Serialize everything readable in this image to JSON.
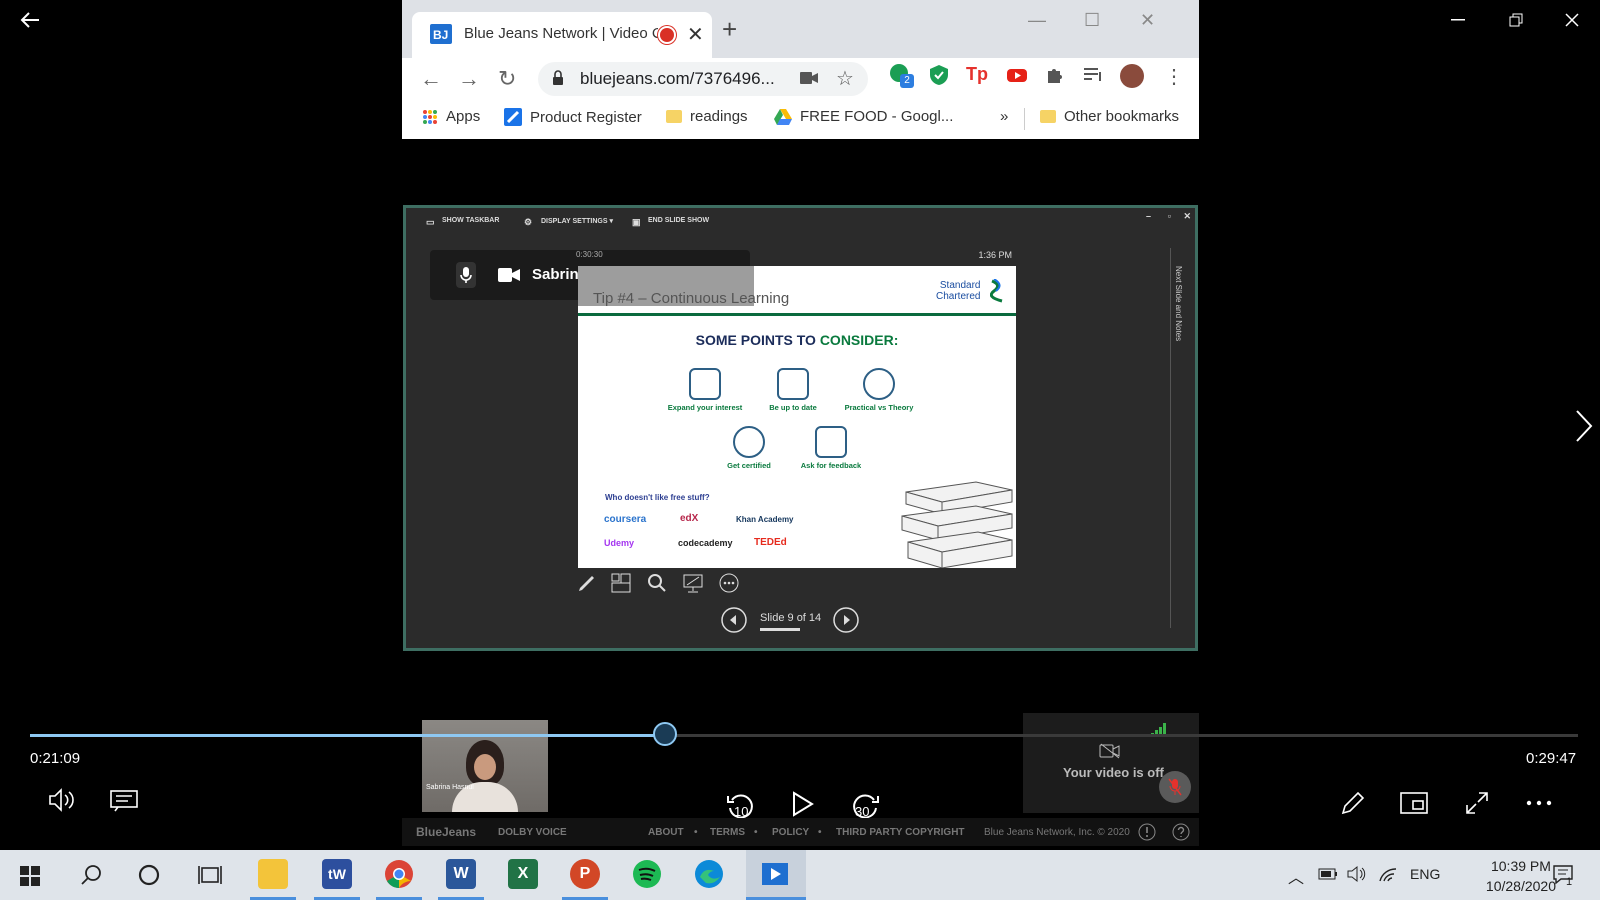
{
  "browser": {
    "tab_title": "Blue Jeans Network | Video C",
    "url": "bluejeans.com/7376496...",
    "bookmarks": [
      "Apps",
      "Product Register",
      "readings",
      "FREE FOOD - Googl...",
      "Other bookmarks"
    ],
    "more_bookmarks": "»",
    "extension_badge": "2"
  },
  "presentation": {
    "toolbar": [
      "SHOW TASKBAR",
      "DISPLAY SETTINGS ▾",
      "END SLIDE SHOW"
    ],
    "speaker_status": "Sabrina Hasnul is talking",
    "elapsed": "0:30:30",
    "clock": "1:36 PM",
    "side_label": "Next Slide and Notes",
    "slide_counter": "Slide 9 of 14",
    "slide": {
      "tip": "Tip #4 – Continuous Learning",
      "logo_line1": "Standard",
      "logo_line2": "Chartered",
      "heading_part1": "SOME POINTS TO ",
      "heading_part2": "CONSIDER:",
      "points": [
        "Expand your interest",
        "Be up to date",
        "Practical vs Theory",
        "Get certified",
        "Ask for feedback"
      ],
      "free_stuff": "Who doesn't like free stuff?",
      "brands": [
        "coursera",
        "edX",
        "Khan Academy",
        "Udemy",
        "codecademy",
        "TEDEd"
      ]
    }
  },
  "player": {
    "elapsed": "0:21:09",
    "duration": "0:29:47",
    "progress": 0.41,
    "skip_back": "10",
    "skip_forward": "30"
  },
  "meeting": {
    "participant_name": "Sabrina Hasnul",
    "video_off": "Your video is off",
    "footer_brand": "BlueJeans",
    "footer_dolby": "DOLBY VOICE",
    "footer_links": [
      "ABOUT",
      "TERMS",
      "POLICY",
      "THIRD PARTY COPYRIGHT"
    ],
    "footer_copyright": "Blue Jeans Network, Inc. © 2020"
  },
  "taskbar": {
    "language": "ENG",
    "time": "10:39 PM",
    "date": "10/28/2020",
    "notification_count": "1"
  }
}
